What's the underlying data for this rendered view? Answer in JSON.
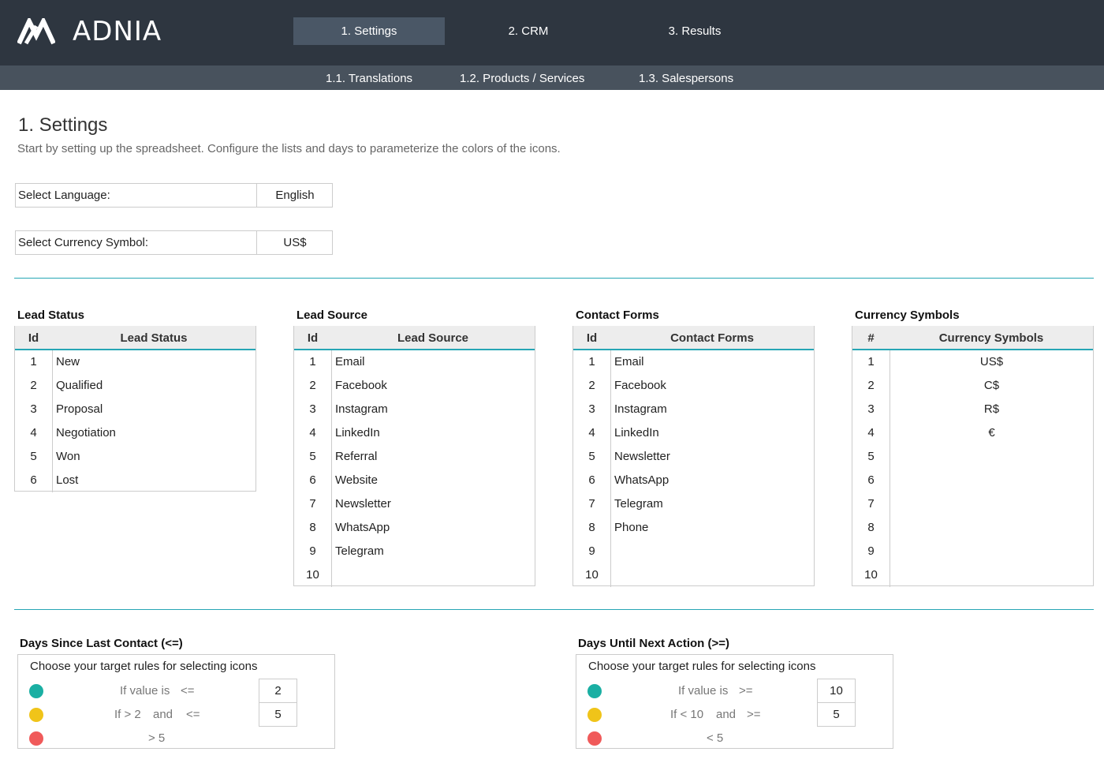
{
  "app": {
    "logo_text": "ADNIA"
  },
  "nav": {
    "tabs": [
      {
        "label": "1. Settings"
      },
      {
        "label": "2. CRM"
      },
      {
        "label": "3. Results"
      }
    ],
    "subtabs": [
      {
        "label": "1.1. Translations"
      },
      {
        "label": "1.2. Products / Services"
      },
      {
        "label": "1.3. Salespersons"
      }
    ]
  },
  "page": {
    "title": "1. Settings",
    "subtitle": "Start by setting up the spreadsheet. Configure the lists and days to parameterize the colors of the icons."
  },
  "settings": {
    "language": {
      "label": "Select Language:",
      "value": "English"
    },
    "currency": {
      "label": "Select Currency Symbol:",
      "value": "US$"
    }
  },
  "tables": {
    "lead_status": {
      "title": "Lead Status",
      "col_id": "Id",
      "col_name": "Lead Status",
      "rows": [
        {
          "id": "1",
          "name": "New"
        },
        {
          "id": "2",
          "name": "Qualified"
        },
        {
          "id": "3",
          "name": "Proposal"
        },
        {
          "id": "4",
          "name": "Negotiation"
        },
        {
          "id": "5",
          "name": "Won"
        },
        {
          "id": "6",
          "name": "Lost"
        }
      ]
    },
    "lead_source": {
      "title": "Lead Source",
      "col_id": "Id",
      "col_name": "Lead Source",
      "rows": [
        {
          "id": "1",
          "name": "Email"
        },
        {
          "id": "2",
          "name": "Facebook"
        },
        {
          "id": "3",
          "name": "Instagram"
        },
        {
          "id": "4",
          "name": "LinkedIn"
        },
        {
          "id": "5",
          "name": "Referral"
        },
        {
          "id": "6",
          "name": "Website"
        },
        {
          "id": "7",
          "name": "Newsletter"
        },
        {
          "id": "8",
          "name": "WhatsApp"
        },
        {
          "id": "9",
          "name": "Telegram"
        },
        {
          "id": "10",
          "name": ""
        }
      ]
    },
    "contact_forms": {
      "title": "Contact Forms",
      "col_id": "Id",
      "col_name": "Contact Forms",
      "rows": [
        {
          "id": "1",
          "name": "Email"
        },
        {
          "id": "2",
          "name": "Facebook"
        },
        {
          "id": "3",
          "name": "Instagram"
        },
        {
          "id": "4",
          "name": "LinkedIn"
        },
        {
          "id": "5",
          "name": "Newsletter"
        },
        {
          "id": "6",
          "name": "WhatsApp"
        },
        {
          "id": "7",
          "name": "Telegram"
        },
        {
          "id": "8",
          "name": "Phone"
        },
        {
          "id": "9",
          "name": ""
        },
        {
          "id": "10",
          "name": ""
        }
      ]
    },
    "currency_symbols": {
      "title": "Currency Symbols",
      "col_id": "#",
      "col_name": "Currency Symbols",
      "rows": [
        {
          "id": "1",
          "name": "US$"
        },
        {
          "id": "2",
          "name": "C$"
        },
        {
          "id": "3",
          "name": "R$"
        },
        {
          "id": "4",
          "name": "€"
        },
        {
          "id": "5",
          "name": ""
        },
        {
          "id": "6",
          "name": ""
        },
        {
          "id": "7",
          "name": ""
        },
        {
          "id": "8",
          "name": ""
        },
        {
          "id": "9",
          "name": ""
        },
        {
          "id": "10",
          "name": ""
        }
      ]
    }
  },
  "rules": {
    "last_contact": {
      "title": "Days Since Last Contact (<=)",
      "heading": "Choose your target rules for selecting icons",
      "rule1": {
        "text": "If value is",
        "op": "<=",
        "value": "2"
      },
      "rule2": {
        "pre": "If > 2",
        "and": "and",
        "op": "<=",
        "value": "5"
      },
      "rule3": {
        "text": "> 5"
      }
    },
    "next_action": {
      "title": "Days Until Next Action (>=)",
      "heading": "Choose your target rules for selecting icons",
      "rule1": {
        "text": "If value is",
        "op": ">=",
        "value": "10"
      },
      "rule2": {
        "pre": "If < 10",
        "and": "and",
        "op": ">=",
        "value": "5"
      },
      "rule3": {
        "text": "< 5"
      }
    }
  },
  "colors": {
    "green": "#1aafa3",
    "yellow": "#f0c419",
    "red": "#f05a5a",
    "accent": "#26a6b5",
    "topbar": "#2e3640"
  }
}
